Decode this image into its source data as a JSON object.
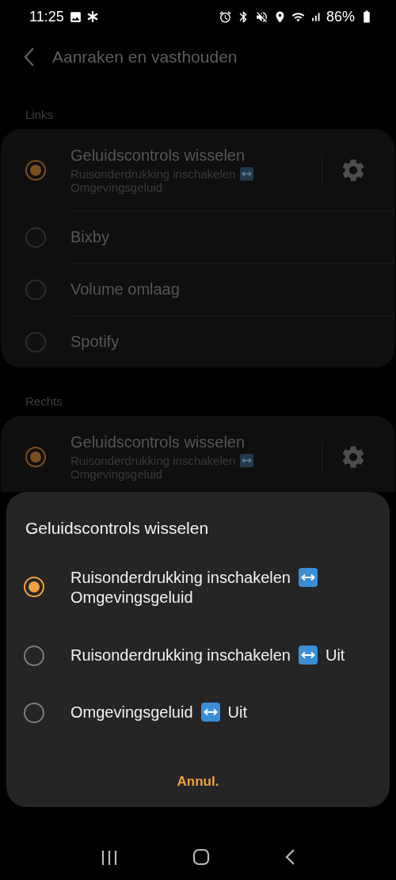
{
  "status_bar": {
    "time": "11:25",
    "battery": "86%"
  },
  "header": {
    "title": "Aanraken en vasthouden"
  },
  "sections": [
    {
      "label": "Links",
      "options": [
        {
          "kind": "swap",
          "title": "Geluidscontrols wisselen",
          "from": "Ruisonderdrukking inschakelen",
          "to": "Omgevingsgeluid",
          "selected": true
        },
        {
          "kind": "plain",
          "title": "Bixby",
          "selected": false
        },
        {
          "kind": "plain",
          "title": "Volume omlaag",
          "selected": false
        },
        {
          "kind": "plain",
          "title": "Spotify",
          "selected": false
        }
      ]
    },
    {
      "label": "Rechts",
      "options": [
        {
          "kind": "swap",
          "title": "Geluidscontrols wisselen",
          "from": "Ruisonderdrukking inschakelen",
          "to": "Omgevingsgeluid",
          "selected": true
        }
      ]
    }
  ],
  "dialog": {
    "title": "Geluidscontrols wisselen",
    "options": [
      {
        "from": "Ruisonderdrukking inschakelen",
        "to": "Omgevingsgeluid",
        "selected": true
      },
      {
        "from": "Ruisonderdrukking inschakelen",
        "to": "Uit",
        "selected": false
      },
      {
        "from": "Omgevingsgeluid",
        "to": "Uit",
        "selected": false
      }
    ],
    "cancel": "Annul."
  }
}
